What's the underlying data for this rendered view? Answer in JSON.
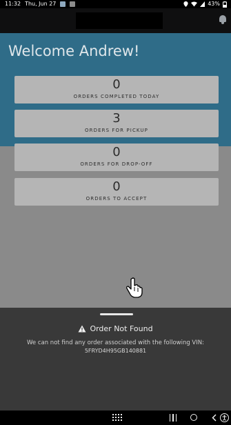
{
  "status_bar": {
    "time": "11:32",
    "date": "Thu, Jun 27",
    "battery": "43%"
  },
  "header": {
    "title_redacted": true
  },
  "hero": {
    "welcome": "Welcome Andrew!",
    "color": "#2f6c88"
  },
  "cards": [
    {
      "value": "0",
      "label": "ORDERS COMPLETED TODAY"
    },
    {
      "value": "3",
      "label": "ORDERS FOR PICKUP"
    },
    {
      "value": "0",
      "label": "ORDERS FOR DROP-OFF"
    },
    {
      "value": "0",
      "label": "ORDERS TO ACCEPT"
    }
  ],
  "sheet": {
    "title": "Order Not Found",
    "message": "We can not find any order associated with the following VIN:",
    "vin": "5FRYD4H95GB140881"
  },
  "icons": {
    "bell": "bell-icon",
    "warning": "warning-icon",
    "pointer": "hand-pointer-icon"
  }
}
